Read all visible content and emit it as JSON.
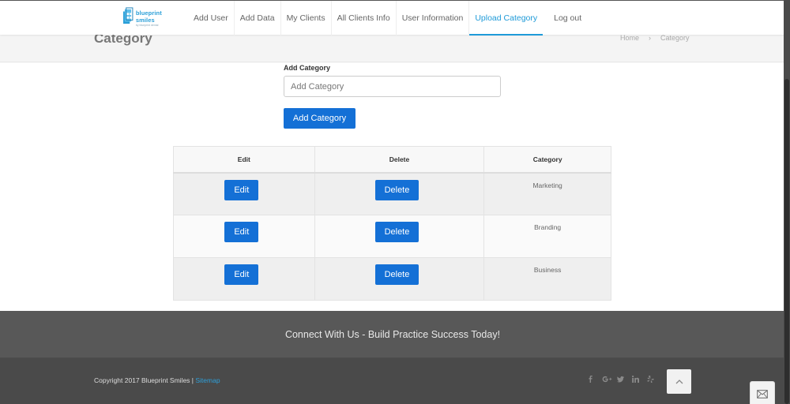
{
  "header": {
    "logo": {
      "name": "blueprint smiles",
      "sub": "by blueprint dental"
    },
    "nav": [
      {
        "label": "Add User"
      },
      {
        "label": "Add Data"
      },
      {
        "label": "My Clients"
      },
      {
        "label": "All Clients Info"
      },
      {
        "label": "User Information"
      },
      {
        "label": "Upload Category"
      },
      {
        "label": "Log out"
      }
    ],
    "active_nav": "Upload Category"
  },
  "title_band": {
    "title": "Category",
    "breadcrumb": {
      "home": "Home",
      "separator": "›",
      "current": "Category"
    }
  },
  "form": {
    "label": "Add Category",
    "placeholder": "Add Category",
    "value": "",
    "submit_label": "Add Category"
  },
  "table": {
    "headers": {
      "edit": "Edit",
      "delete": "Delete",
      "category": "Category"
    },
    "rows": [
      {
        "edit_label": "Edit",
        "delete_label": "Delete",
        "category": "Marketing"
      },
      {
        "edit_label": "Edit",
        "delete_label": "Delete",
        "category": "Branding"
      },
      {
        "edit_label": "Edit",
        "delete_label": "Delete",
        "category": "Business"
      }
    ]
  },
  "footer": {
    "tagline": "Connect With Us - Build Practice Success Today!",
    "copyright": "Copyright 2017 Blueprint Smiles | ",
    "sitemap_label": "Sitemap",
    "socials": [
      "facebook-icon",
      "google-plus-icon",
      "twitter-icon",
      "linkedin-icon",
      "yelp-icon"
    ]
  },
  "colors": {
    "accent": "#1e9ad8",
    "button": "#1470d6",
    "footer_top": "#585858",
    "footer_bottom": "#4a4a4a"
  }
}
